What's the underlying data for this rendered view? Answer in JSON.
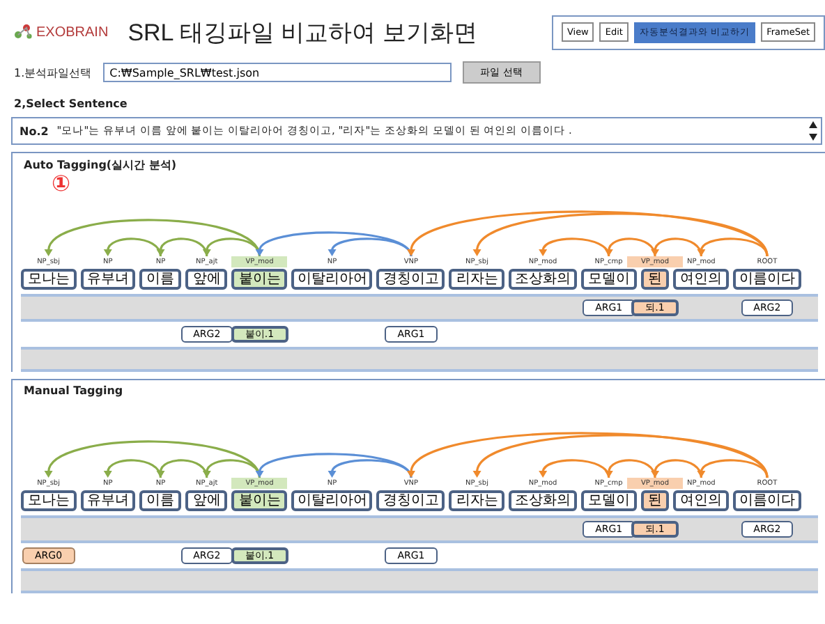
{
  "header": {
    "logo": "EXOBRAIN",
    "title": "SRL 태깅파일 비교하여 보기화면",
    "modes": [
      {
        "label": "View",
        "selected": false
      },
      {
        "label": "Edit",
        "selected": false
      },
      {
        "label": "자동분석결과와 비교하기",
        "selected": true
      },
      {
        "label": "FrameSet",
        "selected": false
      }
    ]
  },
  "file_select": {
    "label": "1.분석파일선택",
    "value": "C:₩Sample_SRL₩test.json",
    "button": "파일 선택"
  },
  "sentence": {
    "heading": "2,Select Sentence",
    "number": "No.2",
    "text": "\"모나\"는 유부녀 이름 앞에 붙이는 이탈리아어 경칭이고, \"리자\"는 조상화의 모델이 된 여인의 이름이다 ."
  },
  "panels": [
    {
      "title": "Auto Tagging(실시간 분석)",
      "marker": "①",
      "tokens": [
        {
          "word": "모나는",
          "label": "NP_sbj"
        },
        {
          "word": "유부녀",
          "label": "NP"
        },
        {
          "word": "이름",
          "label": "NP"
        },
        {
          "word": "앞에",
          "label": "NP_ajt",
          "arg_bottom": {
            "text": "ARG2",
            "kind": "plain"
          }
        },
        {
          "word": "붙이는",
          "label": "VP_mod",
          "color": "#d3e8bd",
          "arg_bottom": {
            "text": "붙이.1",
            "kind": "predicate"
          }
        },
        {
          "word": "이탈리아어",
          "label": "NP"
        },
        {
          "word": "경칭이고",
          "label": "VNP",
          "arg_bottom": {
            "text": "ARG1",
            "kind": "plain"
          }
        },
        {
          "word": "리자는",
          "label": "NP_sbj"
        },
        {
          "word": "조상화의",
          "label": "NP_mod"
        },
        {
          "word": "모델이",
          "label": "NP_cmp",
          "arg_top": {
            "text": "ARG1",
            "kind": "plain"
          }
        },
        {
          "word": "된",
          "label": "VP_mod",
          "color": "#f9cfae",
          "arg_top": {
            "text": "되.1",
            "kind": "predicate"
          }
        },
        {
          "word": "여인의",
          "label": "NP_mod"
        },
        {
          "word": "이름이다",
          "label": "ROOT",
          "arg_top": {
            "text": "ARG2",
            "kind": "plain"
          }
        }
      ]
    },
    {
      "title": "Manual Tagging",
      "tokens": [
        {
          "word": "모나는",
          "label": "NP_sbj",
          "arg_bottom": {
            "text": "ARG0",
            "kind": "agent"
          }
        },
        {
          "word": "유부녀",
          "label": "NP"
        },
        {
          "word": "이름",
          "label": "NP"
        },
        {
          "word": "앞에",
          "label": "NP_ajt",
          "arg_bottom": {
            "text": "ARG2",
            "kind": "plain"
          }
        },
        {
          "word": "붙이는",
          "label": "VP_mod",
          "color": "#d3e8bd",
          "arg_bottom": {
            "text": "붙이.1",
            "kind": "predicate"
          }
        },
        {
          "word": "이탈리아어",
          "label": "NP"
        },
        {
          "word": "경칭이고",
          "label": "VNP",
          "arg_bottom": {
            "text": "ARG1",
            "kind": "plain"
          }
        },
        {
          "word": "리자는",
          "label": "NP_sbj"
        },
        {
          "word": "조상화의",
          "label": "NP_mod"
        },
        {
          "word": "모델이",
          "label": "NP_cmp",
          "arg_top": {
            "text": "ARG1",
            "kind": "plain"
          }
        },
        {
          "word": "된",
          "label": "VP_mod",
          "color": "#f9cfae",
          "arg_top": {
            "text": "되.1",
            "kind": "predicate"
          }
        },
        {
          "word": "여인의",
          "label": "NP_mod"
        },
        {
          "word": "이름이다",
          "label": "ROOT",
          "arg_top": {
            "text": "ARG2",
            "kind": "plain"
          }
        }
      ]
    }
  ]
}
